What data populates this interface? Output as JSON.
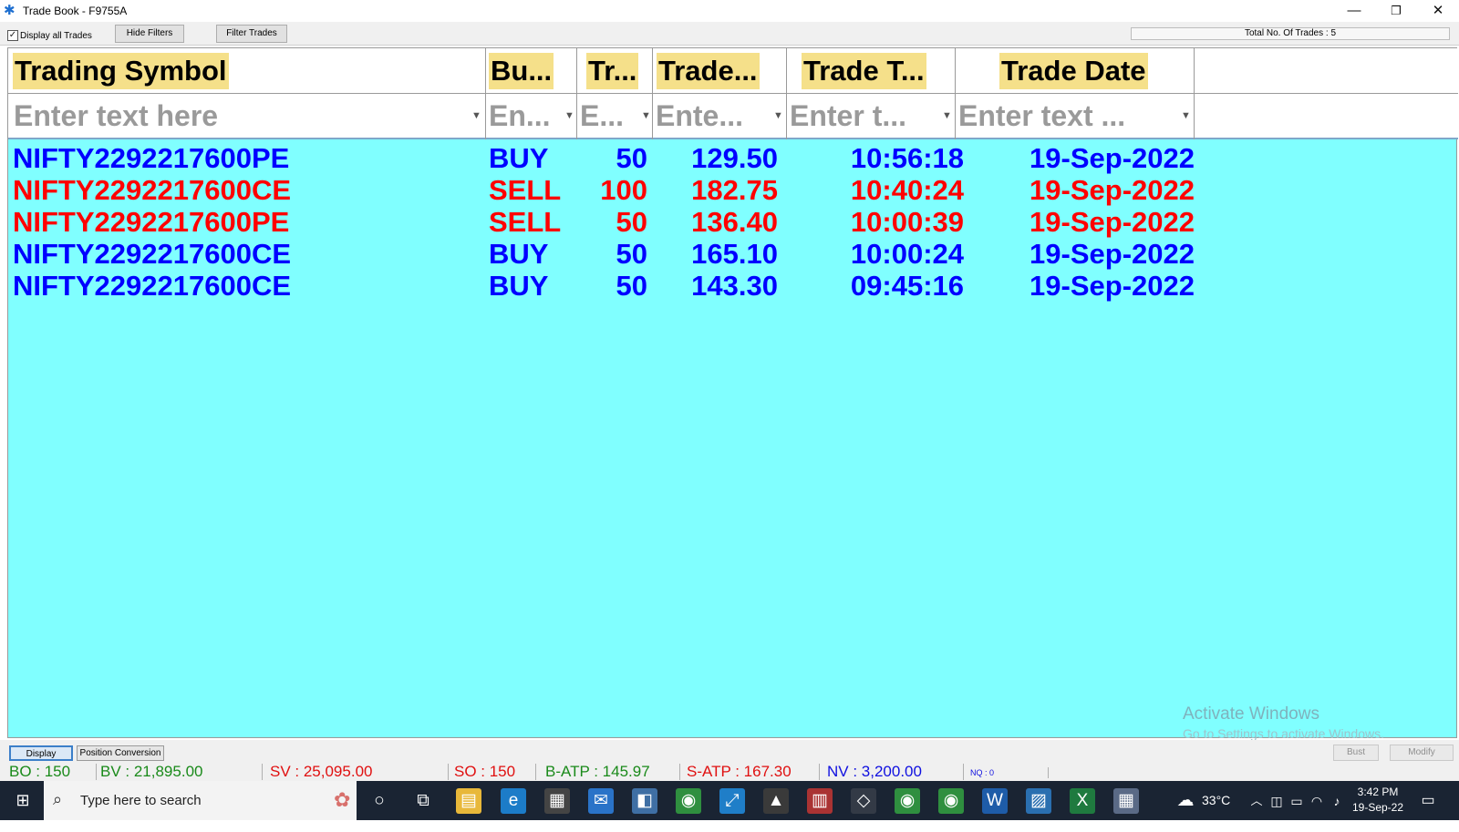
{
  "window": {
    "title": "Trade Book - F9755A"
  },
  "toolbar": {
    "display_all_label": "Display all Trades",
    "display_all_checked": true,
    "hide_filters_label": "Hide Filters",
    "filter_trades_label": "Filter Trades",
    "total_trades_label": "Total No. Of Trades : 5"
  },
  "columns": [
    {
      "header": "Trading Symbol",
      "filter_placeholder": "Enter text here"
    },
    {
      "header": "Bu...",
      "filter_placeholder": "En..."
    },
    {
      "header": "Tr...",
      "filter_placeholder": "E..."
    },
    {
      "header": "Trade...",
      "filter_placeholder": "Ente..."
    },
    {
      "header": "Trade T...",
      "filter_placeholder": "Enter t..."
    },
    {
      "header": "Trade Date",
      "filter_placeholder": "Enter text ..."
    }
  ],
  "trades": [
    {
      "symbol": "NIFTY2292217600PE",
      "side": "BUY",
      "qty": "50",
      "price": "129.50",
      "time": "10:56:18",
      "date": "19-Sep-2022",
      "color": "#0000ff"
    },
    {
      "symbol": "NIFTY2292217600CE",
      "side": "SELL",
      "qty": "100",
      "price": "182.75",
      "time": "10:40:24",
      "date": "19-Sep-2022",
      "color": "#ff0000"
    },
    {
      "symbol": "NIFTY2292217600PE",
      "side": "SELL",
      "qty": "50",
      "price": "136.40",
      "time": "10:00:39",
      "date": "19-Sep-2022",
      "color": "#ff0000"
    },
    {
      "symbol": "NIFTY2292217600CE",
      "side": "BUY",
      "qty": "50",
      "price": "165.10",
      "time": "10:00:24",
      "date": "19-Sep-2022",
      "color": "#0000ff"
    },
    {
      "symbol": "NIFTY2292217600CE",
      "side": "BUY",
      "qty": "50",
      "price": "143.30",
      "time": "09:45:16",
      "date": "19-Sep-2022",
      "color": "#0000ff"
    }
  ],
  "watermark": {
    "line1": "Activate Windows",
    "line2": "Go to Settings to activate Windows."
  },
  "tabs": {
    "display": "Display",
    "position_conversion": "Position Conversion"
  },
  "actions": {
    "bust": "Bust",
    "modify": "Modify"
  },
  "summary": {
    "bo": "BO : 150",
    "bv": "BV : 21,895.00",
    "sv": "SV : 25,095.00",
    "so": "SO : 150",
    "batp": "B-ATP : 145.97",
    "satp": "S-ATP : 167.30",
    "nv": "NV : 3,200.00",
    "nq": "NQ : 0"
  },
  "colors": {
    "grid_bg": "#80ffff",
    "header_bg": "#f5e08a",
    "buy": "#0000ff",
    "sell": "#ff0000",
    "summary_green": "#1a8a1a",
    "summary_red": "#e01010",
    "summary_blue": "#1010e0"
  },
  "taskbar": {
    "search_placeholder": "Type here to search",
    "weather": "33°C",
    "time": "3:42 PM",
    "date": "19-Sep-22",
    "icons": [
      "cortana-icon",
      "task-view-icon",
      "file-explorer-icon",
      "edge-icon",
      "store-icon",
      "mail-icon",
      "app-icon",
      "chrome-icon",
      "remote-icon",
      "drive-icon",
      "winrar-icon",
      "trading-app-icon",
      "chrome-icon",
      "chrome-icon",
      "word-icon",
      "photos-icon",
      "excel-icon",
      "calculator-icon"
    ]
  }
}
